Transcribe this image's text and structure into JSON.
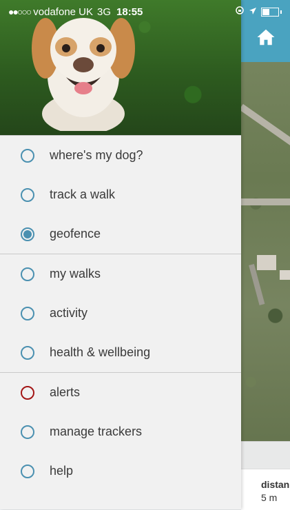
{
  "status_bar": {
    "carrier": "vodafone UK",
    "network": "3G",
    "time": "18:55",
    "signal_bars_filled": 2,
    "signal_bars_total": 5,
    "battery_level": 0.5
  },
  "map": {
    "home_icon": "home-icon",
    "distance_label": "distan",
    "distance_value": "5 m"
  },
  "menu": {
    "sections": [
      {
        "items": [
          {
            "label": "where's my dog?",
            "selected": false,
            "color": "#4a90b0"
          },
          {
            "label": "track a walk",
            "selected": false,
            "color": "#4a90b0"
          },
          {
            "label": "geofence",
            "selected": true,
            "color": "#4a90b0"
          }
        ]
      },
      {
        "items": [
          {
            "label": "my walks",
            "selected": false,
            "color": "#4a90b0"
          },
          {
            "label": "activity",
            "selected": false,
            "color": "#4a90b0"
          },
          {
            "label": "health & wellbeing",
            "selected": false,
            "color": "#4a90b0"
          }
        ]
      },
      {
        "items": [
          {
            "label": "alerts",
            "selected": false,
            "color": "#a31515"
          },
          {
            "label": "manage trackers",
            "selected": false,
            "color": "#4a90b0"
          },
          {
            "label": "help",
            "selected": false,
            "color": "#4a90b0"
          }
        ]
      }
    ]
  },
  "colors": {
    "accent": "#4a90b0",
    "alert": "#a31515",
    "map_header": "#4aa3c0",
    "drawer_bg": "#f1f1f1"
  }
}
